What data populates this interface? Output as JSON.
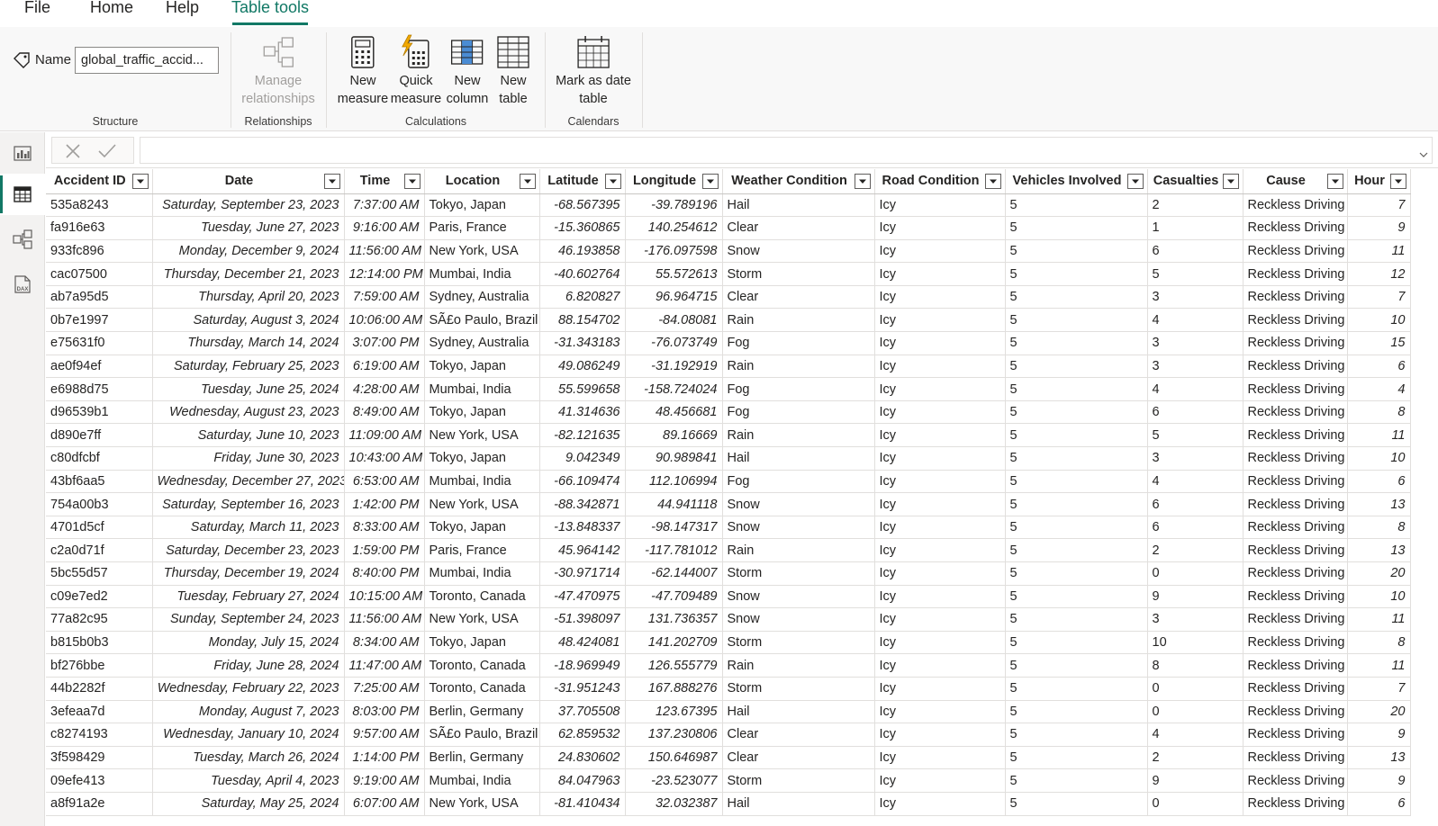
{
  "menu": {
    "tabs": [
      "File",
      "Home",
      "Help",
      "Table tools"
    ],
    "active": "Table tools"
  },
  "ribbon": {
    "structure": {
      "name_label": "Name",
      "name_value": "global_traffic_accid...",
      "group_label": "Structure"
    },
    "relationships": {
      "manage_line1": "Manage",
      "manage_line2": "relationships",
      "group_label": "Relationships"
    },
    "calculations": {
      "new_measure_line1": "New",
      "new_measure_line2": "measure",
      "quick_measure_line1": "Quick",
      "quick_measure_line2": "measure",
      "new_column_line1": "New",
      "new_column_line2": "column",
      "new_table_line1": "New",
      "new_table_line2": "table",
      "group_label": "Calculations"
    },
    "calendars": {
      "mark_line1": "Mark as date",
      "mark_line2": "table",
      "group_label": "Calendars"
    }
  },
  "rail": {
    "icons": [
      "report-view-icon",
      "table-view-icon",
      "model-view-icon",
      "dax-query-icon"
    ],
    "active": "table-view-icon",
    "dax_label": "DAX"
  },
  "colors": {
    "accent": "#117865",
    "grid_line": "#e1dfdd",
    "ribbon_bg": "#f8f8f8"
  },
  "table": {
    "columns": [
      "Accident ID",
      "Date",
      "Time",
      "Location",
      "Latitude",
      "Longitude",
      "Weather Condition",
      "Road Condition",
      "Vehicles Involved",
      "Casualties",
      "Cause",
      "Hour"
    ],
    "rows": [
      [
        "535a8243",
        "Saturday, September 23, 2023",
        "7:37:00 AM",
        "Tokyo, Japan",
        "-68.567395",
        "-39.789196",
        "Hail",
        "Icy",
        "5",
        "2",
        "Reckless Driving",
        "7"
      ],
      [
        "fa916e63",
        "Tuesday, June 27, 2023",
        "9:16:00 AM",
        "Paris, France",
        "-15.360865",
        "140.254612",
        "Clear",
        "Icy",
        "5",
        "1",
        "Reckless Driving",
        "9"
      ],
      [
        "933fc896",
        "Monday, December 9, 2024",
        "11:56:00 AM",
        "New York, USA",
        "46.193858",
        "-176.097598",
        "Snow",
        "Icy",
        "5",
        "6",
        "Reckless Driving",
        "11"
      ],
      [
        "cac07500",
        "Thursday, December 21, 2023",
        "12:14:00 PM",
        "Mumbai, India",
        "-40.602764",
        "55.572613",
        "Storm",
        "Icy",
        "5",
        "5",
        "Reckless Driving",
        "12"
      ],
      [
        "ab7a95d5",
        "Thursday, April 20, 2023",
        "7:59:00 AM",
        "Sydney, Australia",
        "6.820827",
        "96.964715",
        "Clear",
        "Icy",
        "5",
        "3",
        "Reckless Driving",
        "7"
      ],
      [
        "0b7e1997",
        "Saturday, August 3, 2024",
        "10:06:00 AM",
        "SÃ£o Paulo, Brazil",
        "88.154702",
        "-84.08081",
        "Rain",
        "Icy",
        "5",
        "4",
        "Reckless Driving",
        "10"
      ],
      [
        "e75631f0",
        "Thursday, March 14, 2024",
        "3:07:00 PM",
        "Sydney, Australia",
        "-31.343183",
        "-76.073749",
        "Fog",
        "Icy",
        "5",
        "3",
        "Reckless Driving",
        "15"
      ],
      [
        "ae0f94ef",
        "Saturday, February 25, 2023",
        "6:19:00 AM",
        "Tokyo, Japan",
        "49.086249",
        "-31.192919",
        "Rain",
        "Icy",
        "5",
        "3",
        "Reckless Driving",
        "6"
      ],
      [
        "e6988d75",
        "Tuesday, June 25, 2024",
        "4:28:00 AM",
        "Mumbai, India",
        "55.599658",
        "-158.724024",
        "Fog",
        "Icy",
        "5",
        "4",
        "Reckless Driving",
        "4"
      ],
      [
        "d96539b1",
        "Wednesday, August 23, 2023",
        "8:49:00 AM",
        "Tokyo, Japan",
        "41.314636",
        "48.456681",
        "Fog",
        "Icy",
        "5",
        "6",
        "Reckless Driving",
        "8"
      ],
      [
        "d890e7ff",
        "Saturday, June 10, 2023",
        "11:09:00 AM",
        "New York, USA",
        "-82.121635",
        "89.16669",
        "Rain",
        "Icy",
        "5",
        "5",
        "Reckless Driving",
        "11"
      ],
      [
        "c80dfcbf",
        "Friday, June 30, 2023",
        "10:43:00 AM",
        "Tokyo, Japan",
        "9.042349",
        "90.989841",
        "Hail",
        "Icy",
        "5",
        "3",
        "Reckless Driving",
        "10"
      ],
      [
        "43bf6aa5",
        "Wednesday, December 27, 2023",
        "6:53:00 AM",
        "Mumbai, India",
        "-66.109474",
        "112.106994",
        "Fog",
        "Icy",
        "5",
        "4",
        "Reckless Driving",
        "6"
      ],
      [
        "754a00b3",
        "Saturday, September 16, 2023",
        "1:42:00 PM",
        "New York, USA",
        "-88.342871",
        "44.941118",
        "Snow",
        "Icy",
        "5",
        "6",
        "Reckless Driving",
        "13"
      ],
      [
        "4701d5cf",
        "Saturday, March 11, 2023",
        "8:33:00 AM",
        "Tokyo, Japan",
        "-13.848337",
        "-98.147317",
        "Snow",
        "Icy",
        "5",
        "6",
        "Reckless Driving",
        "8"
      ],
      [
        "c2a0d71f",
        "Saturday, December 23, 2023",
        "1:59:00 PM",
        "Paris, France",
        "45.964142",
        "-117.781012",
        "Rain",
        "Icy",
        "5",
        "2",
        "Reckless Driving",
        "13"
      ],
      [
        "5bc55d57",
        "Thursday, December 19, 2024",
        "8:40:00 PM",
        "Mumbai, India",
        "-30.971714",
        "-62.144007",
        "Storm",
        "Icy",
        "5",
        "0",
        "Reckless Driving",
        "20"
      ],
      [
        "c09e7ed2",
        "Tuesday, February 27, 2024",
        "10:15:00 AM",
        "Toronto, Canada",
        "-47.470975",
        "-47.709489",
        "Snow",
        "Icy",
        "5",
        "9",
        "Reckless Driving",
        "10"
      ],
      [
        "77a82c95",
        "Sunday, September 24, 2023",
        "11:56:00 AM",
        "New York, USA",
        "-51.398097",
        "131.736357",
        "Snow",
        "Icy",
        "5",
        "3",
        "Reckless Driving",
        "11"
      ],
      [
        "b815b0b3",
        "Monday, July 15, 2024",
        "8:34:00 AM",
        "Tokyo, Japan",
        "48.424081",
        "141.202709",
        "Storm",
        "Icy",
        "5",
        "10",
        "Reckless Driving",
        "8"
      ],
      [
        "bf276bbe",
        "Friday, June 28, 2024",
        "11:47:00 AM",
        "Toronto, Canada",
        "-18.969949",
        "126.555779",
        "Rain",
        "Icy",
        "5",
        "8",
        "Reckless Driving",
        "11"
      ],
      [
        "44b2282f",
        "Wednesday, February 22, 2023",
        "7:25:00 AM",
        "Toronto, Canada",
        "-31.951243",
        "167.888276",
        "Storm",
        "Icy",
        "5",
        "0",
        "Reckless Driving",
        "7"
      ],
      [
        "3efeaa7d",
        "Monday, August 7, 2023",
        "8:03:00 PM",
        "Berlin, Germany",
        "37.705508",
        "123.67395",
        "Hail",
        "Icy",
        "5",
        "0",
        "Reckless Driving",
        "20"
      ],
      [
        "c8274193",
        "Wednesday, January 10, 2024",
        "9:57:00 AM",
        "SÃ£o Paulo, Brazil",
        "62.859532",
        "137.230806",
        "Clear",
        "Icy",
        "5",
        "4",
        "Reckless Driving",
        "9"
      ],
      [
        "3f598429",
        "Tuesday, March 26, 2024",
        "1:14:00 PM",
        "Berlin, Germany",
        "24.830602",
        "150.646987",
        "Clear",
        "Icy",
        "5",
        "2",
        "Reckless Driving",
        "13"
      ],
      [
        "09efe413",
        "Tuesday, April 4, 2023",
        "9:19:00 AM",
        "Mumbai, India",
        "84.047963",
        "-23.523077",
        "Storm",
        "Icy",
        "5",
        "9",
        "Reckless Driving",
        "9"
      ],
      [
        "a8f91a2e",
        "Saturday, May 25, 2024",
        "6:07:00 AM",
        "New York, USA",
        "-81.410434",
        "32.032387",
        "Hail",
        "Icy",
        "5",
        "0",
        "Reckless Driving",
        "6"
      ]
    ]
  }
}
